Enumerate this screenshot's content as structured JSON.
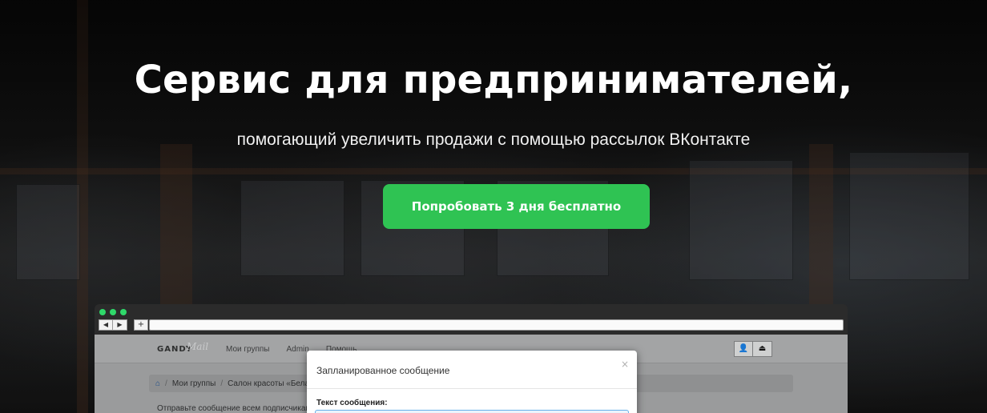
{
  "hero": {
    "title": "Сервис для предпринимателей,",
    "subtitle": "помогающий увеличить продажи с помощью рассылок ВКонтакте",
    "cta_label": "Попробовать 3 дня бесплатно"
  },
  "colors": {
    "accent_green": "#2fc353",
    "window_dot_green": "#2fd86a",
    "modal_focus_blue": "#66afe9"
  },
  "browser": {
    "back_icon": "◀",
    "forward_icon": "▶",
    "new_tab_icon": "+"
  },
  "app": {
    "logo_text": "GANDY",
    "logo_script": "Mail",
    "nav": [
      "Мои группы",
      "Admin",
      "Помощь"
    ],
    "user_icon": "👤",
    "logout_icon": "⏏",
    "breadcrumb": [
      "Мои группы",
      "Салон красоты «Бела"
    ],
    "body_text": "Отправьте сообщение всем подписчикам"
  },
  "modal": {
    "title": "Запланированное сообщение",
    "close": "×",
    "field_label": "Текст сообщения:"
  }
}
